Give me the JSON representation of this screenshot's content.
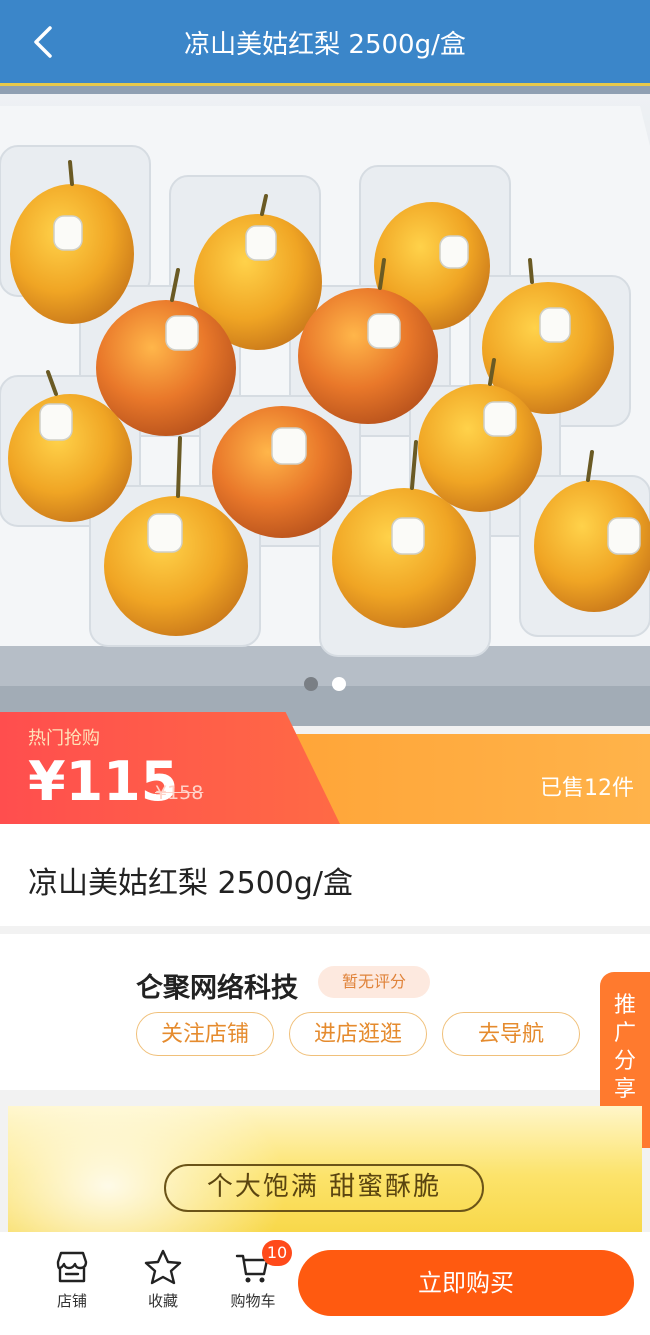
{
  "header": {
    "title": "凉山美姑红梨 2500g/盒"
  },
  "gallery": {
    "image": "pear-gift-box-photo",
    "slide_count": 2,
    "active_slide": 2
  },
  "price": {
    "hot_label": "热门抢购",
    "current": "¥115",
    "original": "¥158",
    "sold": "已售12件",
    "colors": {
      "left": "#ff4e4e",
      "right": "#ffa53a"
    }
  },
  "product": {
    "title": "凉山美姑红梨 2500g/盒"
  },
  "shop": {
    "name": "仑聚网络科技",
    "rating": "暂无评分",
    "buttons": [
      "关注店铺",
      "进店逛逛",
      "去导航"
    ]
  },
  "promo_float": {
    "chars": [
      "推",
      "广",
      "分",
      "享"
    ],
    "icon": "send-arrow-icon"
  },
  "banner": {
    "slogan": "个大饱满  甜蜜酥脆"
  },
  "tabbar": {
    "tabs": [
      {
        "label": "店铺",
        "icon": "store-icon"
      },
      {
        "label": "收藏",
        "icon": "star-icon"
      },
      {
        "label": "购物车",
        "icon": "cart-icon"
      }
    ],
    "cart_count": "10",
    "buy_label": "立即购买",
    "accent": "#ff5a10"
  },
  "nav_colors": {
    "bar": "#3b86c9",
    "line": "#e8c94a"
  }
}
